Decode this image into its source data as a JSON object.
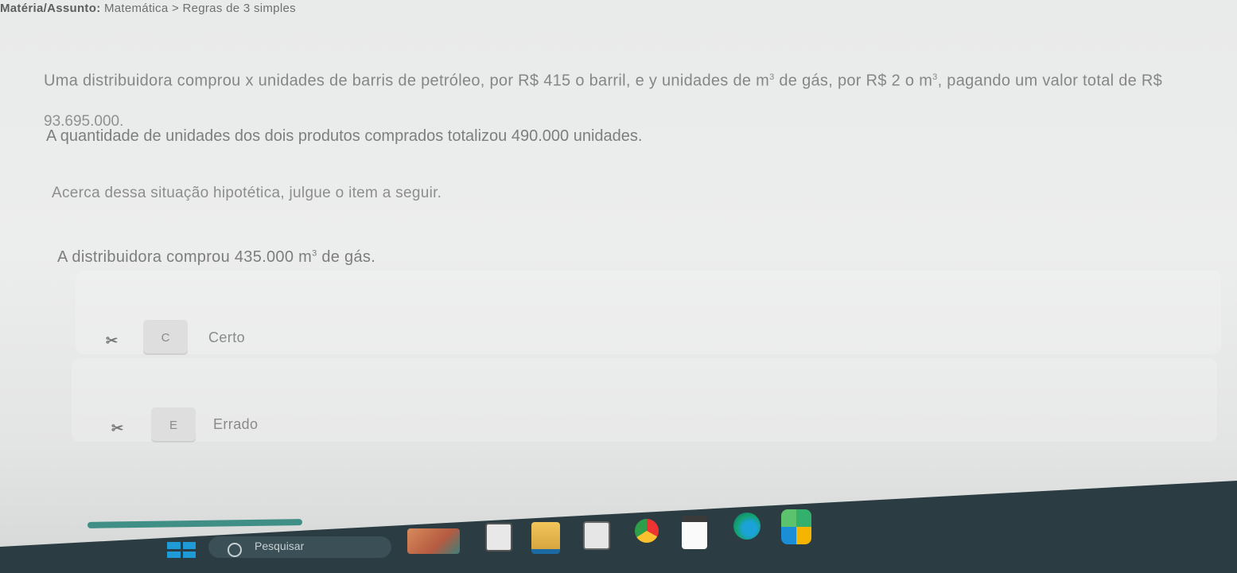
{
  "topic": {
    "prefix": "Matéria/Assunto:",
    "value": "Matemática > Regras de 3 simples"
  },
  "question": {
    "line1_before_m": "Uma distribuidora comprou x unidades de barris de petróleo, por R$ 415 o barril, e y unidades de m",
    "line1_mid": " de gás, por R$ 2 o m",
    "line1_after": ", pagando um valor total de R$",
    "exp": "3",
    "line2": "93.695.000.",
    "line3": "A quantidade de unidades dos dois produtos comprados totalizou 490.000 unidades."
  },
  "instruction": "Acerca dessa situação hipotética, julgue o item a seguir.",
  "statement": {
    "before": "A distribuidora comprou 435.000 m",
    "exp": "3",
    "after": " de gás."
  },
  "options": [
    {
      "key": "C",
      "label": "Certo"
    },
    {
      "key": "E",
      "label": "Errado"
    }
  ],
  "taskbar": {
    "search_placeholder": "Pesquisar",
    "apps": [
      "widgets-icon",
      "file-explorer-icon",
      "folder-icon",
      "store-icon",
      "chrome-icon",
      "calendar-icon",
      "edge-icon",
      "photos-icon"
    ]
  }
}
